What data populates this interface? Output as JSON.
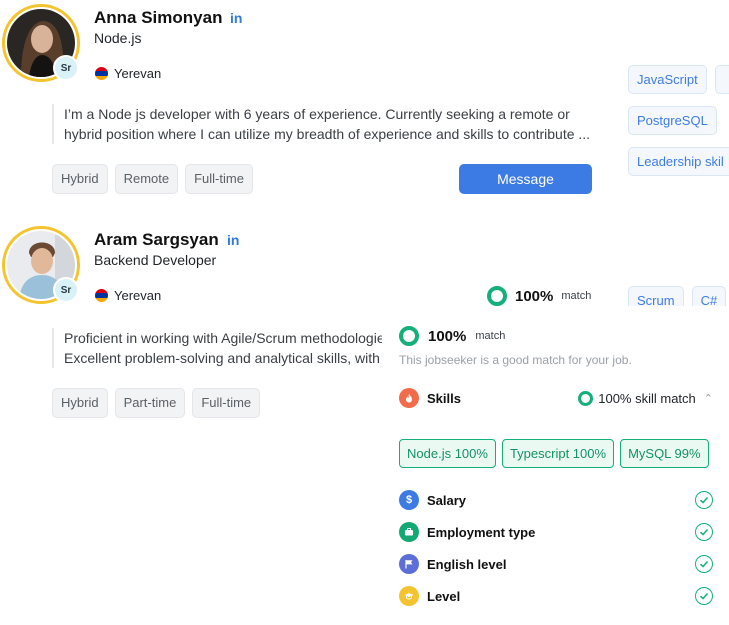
{
  "candidates": [
    {
      "name": "Anna Simonyan",
      "role": "Node.js",
      "level_badge": "Sr",
      "location": "Yerevan",
      "bio_line1": "I’m a Node js developer with 6 years of experience. Currently seeking a remote or",
      "bio_line2": "hybrid position where I can utilize my breadth of experience and skills to contribute ...",
      "work_types": [
        "Hybrid",
        "Remote",
        "Full-time"
      ],
      "message_label": "Message",
      "skills": [
        "JavaScript",
        "PostgreSQL",
        "Leadership skil"
      ]
    },
    {
      "name": "Aram Sargsyan",
      "role": "Backend Developer",
      "level_badge": "Sr",
      "location": "Yerevan",
      "bio_line1": "Proficient in working with Agile/Scrum methodologies",
      "bio_line2": "Excellent problem-solving and analytical skills, with a",
      "work_types": [
        "Hybrid",
        "Part-time",
        "Full-time"
      ],
      "match_percent": "100%",
      "match_word": "match",
      "skills": [
        "Scrum",
        "C#"
      ]
    }
  ],
  "linkedin_icon": "in",
  "match_popover": {
    "percent": "100%",
    "match_word": "match",
    "subtitle": "This jobseeker is a good match for your job.",
    "skills_label": "Skills",
    "skill_match": "100% skill match",
    "skill_tags": [
      "Node.js 100%",
      "Typescript 100%",
      "MySQL 99%"
    ],
    "criteria": [
      {
        "label": "Salary",
        "icon": "dollar-icon",
        "color": "#3d7be4"
      },
      {
        "label": "Employment type",
        "icon": "briefcase-icon",
        "color": "#14a874"
      },
      {
        "label": "English level",
        "icon": "flag-icon",
        "color": "#5b6fd6"
      },
      {
        "label": "Level",
        "icon": "graduation-cap-icon",
        "color": "#f4c430"
      }
    ]
  },
  "colors": {
    "accent_blue": "#3d7be4",
    "match_green": "#14b07a",
    "avatar_ring": "#f4c430",
    "skills_icon": "#f26b4a"
  }
}
